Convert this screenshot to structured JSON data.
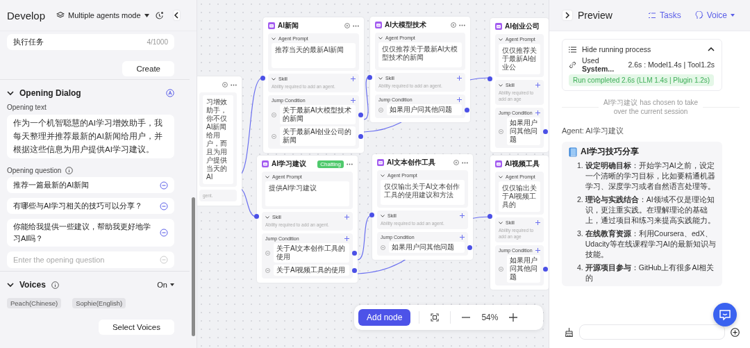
{
  "develop": {
    "title": "Develop",
    "mode": "Multiple agents mode",
    "task": {
      "value": "执行任务",
      "counter": "4/1000"
    },
    "create": "Create",
    "opening_dialog": {
      "title": "Opening Dialog",
      "expanded": true,
      "text_label": "Opening text",
      "text": "作为一个机智聪慧的AI学习增效助手，我每天整理并推荐最新的AI新闻给用户，并根据这些信息为用户提供AI学习建议。",
      "question_label": "Opening question",
      "questions": [
        "推荐一篇最新的AI新闻",
        "有哪些与AI学习相关的技巧可以分享？",
        "你能给我提供一些建议，帮助我更好地学习AI吗？"
      ],
      "question_placeholder": "Enter the opening question"
    },
    "voices": {
      "title": "Voices",
      "expanded": true,
      "toggle": "On",
      "tags": [
        "Peach(Chinese)",
        "Sophie(English)"
      ],
      "button": "Select Voices"
    }
  },
  "canvas": {
    "nodes": [
      {
        "run_button": true,
        "prompt": "习增效助手，你不仅AI新闻给用户，而且为用户提供当天的AI",
        "skill_hint": "gent."
      },
      {
        "title": "AI新闻",
        "run_button": true,
        "prompt_label": "Agent Prompt",
        "prompt": "推荐当天的最新AI新闻",
        "skill_label": "Skill",
        "skill_hint": "Ability required to add an agent.",
        "jump_label": "Jump Condition",
        "conditions": [
          "关于最新AI大模型技术的新闻",
          "关于最新AI创业公司的新闻"
        ]
      },
      {
        "title": "AI大模型技术",
        "run_button": true,
        "prompt_label": "Agent Prompt",
        "prompt": "仅仅推荐关于最新AI大模型技术的新闻",
        "skill_label": "Skill",
        "skill_hint": "Ability required to add an agent.",
        "jump_label": "Jump Condition",
        "conditions": [
          "如果用户问其他问题"
        ]
      },
      {
        "title": "AI创业公司",
        "run_button": false,
        "prompt_label": "Agent Prompt",
        "prompt": "仅仅推荐关于最新AI创业公",
        "skill_label": "Skill",
        "skill_hint": "Ability required to add an age",
        "jump_label": "Jump Condition",
        "conditions": [
          "如果用户问其他问题"
        ]
      },
      {
        "title": "AI学习建议",
        "badge": "Chatting",
        "run_button": false,
        "prompt_label": "Agent Prompt",
        "prompt": "提供AI学习建议",
        "skill_label": "Skill",
        "skill_hint": "Ability required to add an agent.",
        "jump_label": "Jump Condition",
        "conditions": [
          "关于AI文本创作工具的使用",
          "关于AI视频工具的使用"
        ]
      },
      {
        "title": "AI文本创作工具",
        "run_button": true,
        "prompt_label": "Agent Prompt",
        "prompt": "仅仅输出关于AI文本创作工具的使用建议和方法",
        "skill_label": "Skill",
        "skill_hint": "Ability required to add an agent.",
        "jump_label": "Jump Condition",
        "conditions": [
          "如果用户问其他问题"
        ]
      },
      {
        "title": "AI视频工具",
        "run_button": false,
        "prompt_label": "Agent Prompt",
        "prompt": "仅仅输出关于AI视频工具的",
        "skill_label": "Skill",
        "skill_hint": "Ability required to add an age",
        "jump_label": "Jump Condition",
        "conditions": [
          "如果用户问其他问题"
        ]
      }
    ],
    "add_node": "Add node",
    "zoom": "54%"
  },
  "preview": {
    "title": "Preview",
    "tasks": "Tasks",
    "voice": "Voice",
    "process": {
      "toggle": "Hide running process",
      "expanded": true,
      "used": "Used **System...**",
      "timing": "2.6s : Model1.4s | Tool1.2s",
      "status": "Run completed 2.6s  (LLM 1.4s | Plugin 1.2s)"
    },
    "handoff": "AI学习建议 has chosen to take over the current session",
    "agent": "Agent:  AI学习建议",
    "message": {
      "title": "AI学习技巧分享",
      "items": [
        {
          "number": "1.",
          "text": "**设定明确目标**：开始学习AI之前，设定一个清晰的学习目标，比如要精通机器学习、深度学习或者自然语言处理等。"
        },
        {
          "number": "2.",
          "text": "**理论与实践结合**：AI领域不仅是理论知识，更注重实践。在理解理论的基础上，通过项目和练习来提高实践能力。"
        },
        {
          "number": "3.",
          "text": "**在线教育资源**：利用Coursera、edX、Udacity等在线课程学习AI的最新知识与技能。"
        },
        {
          "number": "4.",
          "text": "**开源项目参与**：GitHub上有很多AI相关的"
        }
      ]
    }
  }
}
